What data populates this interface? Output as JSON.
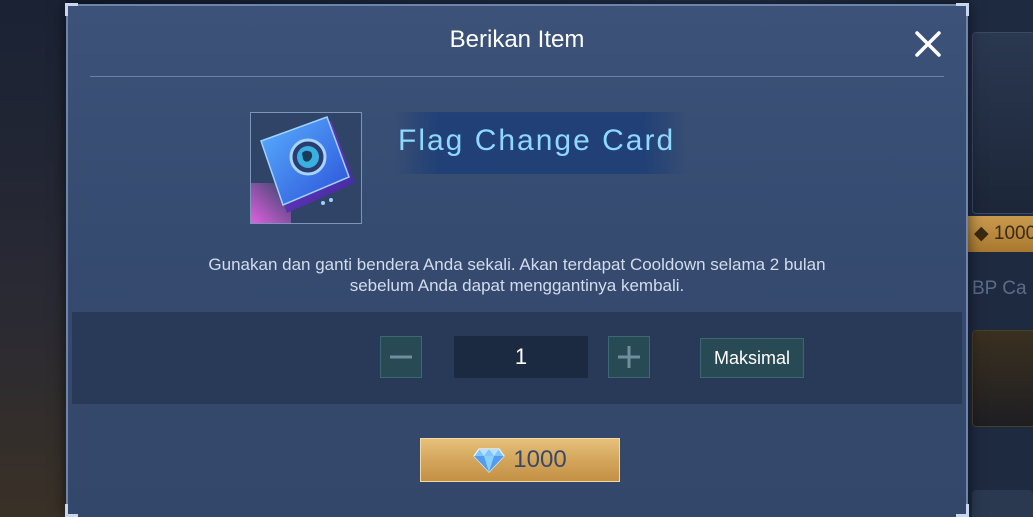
{
  "background": {
    "side_price": "1000",
    "side_label": "BP Ca"
  },
  "dialog": {
    "title": "Berikan Item",
    "close_icon": "close-icon"
  },
  "item": {
    "icon": "flag-change-card-icon",
    "name": "Flag Change Card",
    "description_line1": "Gunakan dan ganti bendera Anda sekali. Akan terdapat Cooldown selama 2 bulan",
    "description_line2": "sebelum Anda dapat menggantinya kembali."
  },
  "quantity": {
    "value": "1",
    "minus_icon": "minus-icon",
    "plus_icon": "plus-icon",
    "max_label": "Maksimal"
  },
  "purchase": {
    "currency_icon": "diamond-icon",
    "price": "1000"
  },
  "colors": {
    "dialog_bg": "#3a5076",
    "item_name": "#8fd8ff",
    "buy_button": "#d3a65c"
  }
}
